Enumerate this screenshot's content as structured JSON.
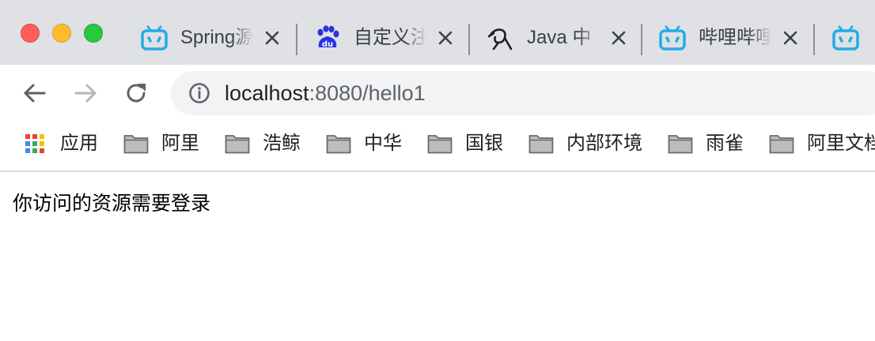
{
  "window_controls": {
    "close": "close",
    "minimize": "minimize",
    "zoom": "zoom"
  },
  "colors": {
    "tabstrip_bg": "#dfe1e5",
    "bilibili_blue": "#23ade5",
    "baidu_blue": "#2932e1",
    "traffic_red": "#ff5f57",
    "traffic_yellow": "#febc2e",
    "traffic_green": "#28c840"
  },
  "tabs": [
    {
      "title": "Spring源",
      "icon": "bilibili-icon"
    },
    {
      "title": "自定义注",
      "icon": "baidu-icon"
    },
    {
      "title": "Java 中",
      "icon": "yuque-icon"
    },
    {
      "title": "哔哩哔哩",
      "icon": "bilibili-icon"
    },
    {
      "title": "",
      "icon": "bilibili-icon"
    }
  ],
  "toolbar": {
    "back_icon": "back-arrow-icon",
    "forward_icon": "forward-arrow-icon",
    "reload_icon": "reload-icon",
    "info_icon": "info-icon"
  },
  "address_bar": {
    "host": "localhost",
    "rest": ":8080/hello1"
  },
  "bookmarks": {
    "apps_label": "应用",
    "items": [
      {
        "label": "阿里",
        "icon": "folder-icon"
      },
      {
        "label": "浩鲸",
        "icon": "folder-icon"
      },
      {
        "label": "中华",
        "icon": "folder-icon"
      },
      {
        "label": "国银",
        "icon": "folder-icon"
      },
      {
        "label": "内部环境",
        "icon": "folder-icon"
      },
      {
        "label": "雨雀",
        "icon": "folder-icon"
      },
      {
        "label": "阿里文档",
        "icon": "folder-icon"
      }
    ]
  },
  "page": {
    "message": "你访问的资源需要登录"
  }
}
